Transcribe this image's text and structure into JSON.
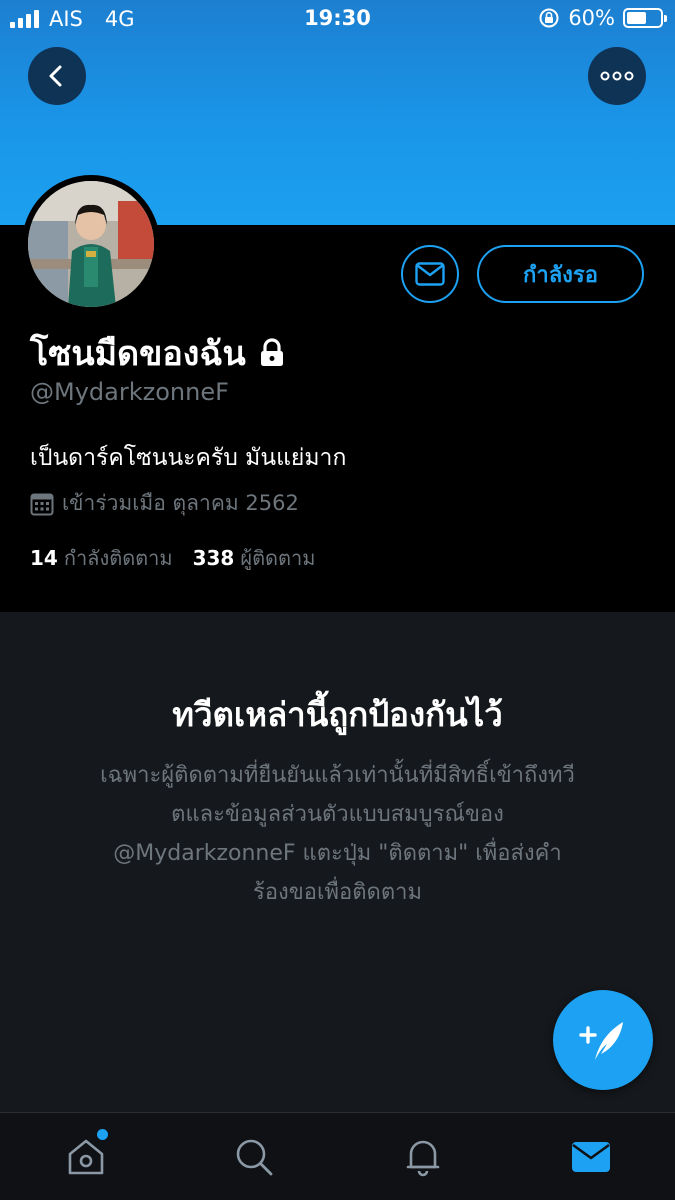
{
  "status_bar": {
    "carrier": "AIS",
    "network": "4G",
    "time": "19:30",
    "battery": "60%",
    "battery_level": 0.6
  },
  "profile": {
    "display_name": "โซนมืดของฉัน",
    "handle": "@MydarkzonneF",
    "bio": "เป็นดาร์คโซนนะครับ มันแย่มาก",
    "joined": "เข้าร่วมเมือ ตุลาคม 2562",
    "following_count": "14",
    "following_label": "กำลังติดตาม",
    "followers_count": "338",
    "followers_label": "ผู้ติดตาม",
    "pending_label": "กำลังรอ"
  },
  "protected": {
    "title": "ทวีตเหล่านี้ถูกป้องกันไว้",
    "body_lines": [
      "เฉพาะผู้ติดตามที่ยืนยันแล้วเท่านั้นที่มีสิทธิ์เข้าถึงทวี",
      "ตและข้อมูลส่วนตัวแบบสมบูรณ์ของ",
      "@MydarkzonneF แตะปุ่ม \"ติดตาม\" เพื่อส่งคำ",
      "ร้องขอเพื่อติดตาม"
    ]
  },
  "colors": {
    "accent": "#1da1f2",
    "banner": "#1a95e8",
    "muted_text": "#6e767d",
    "panel": "#15181c"
  },
  "icons": {
    "back": "back-arrow-icon",
    "more": "more-options-icon",
    "lock": "lock-icon",
    "calendar": "calendar-icon",
    "message": "message-icon",
    "compose": "compose-tweet-icon",
    "home": "home-icon",
    "search": "search-icon",
    "notifications": "notifications-icon",
    "dm": "direct-messages-icon"
  }
}
